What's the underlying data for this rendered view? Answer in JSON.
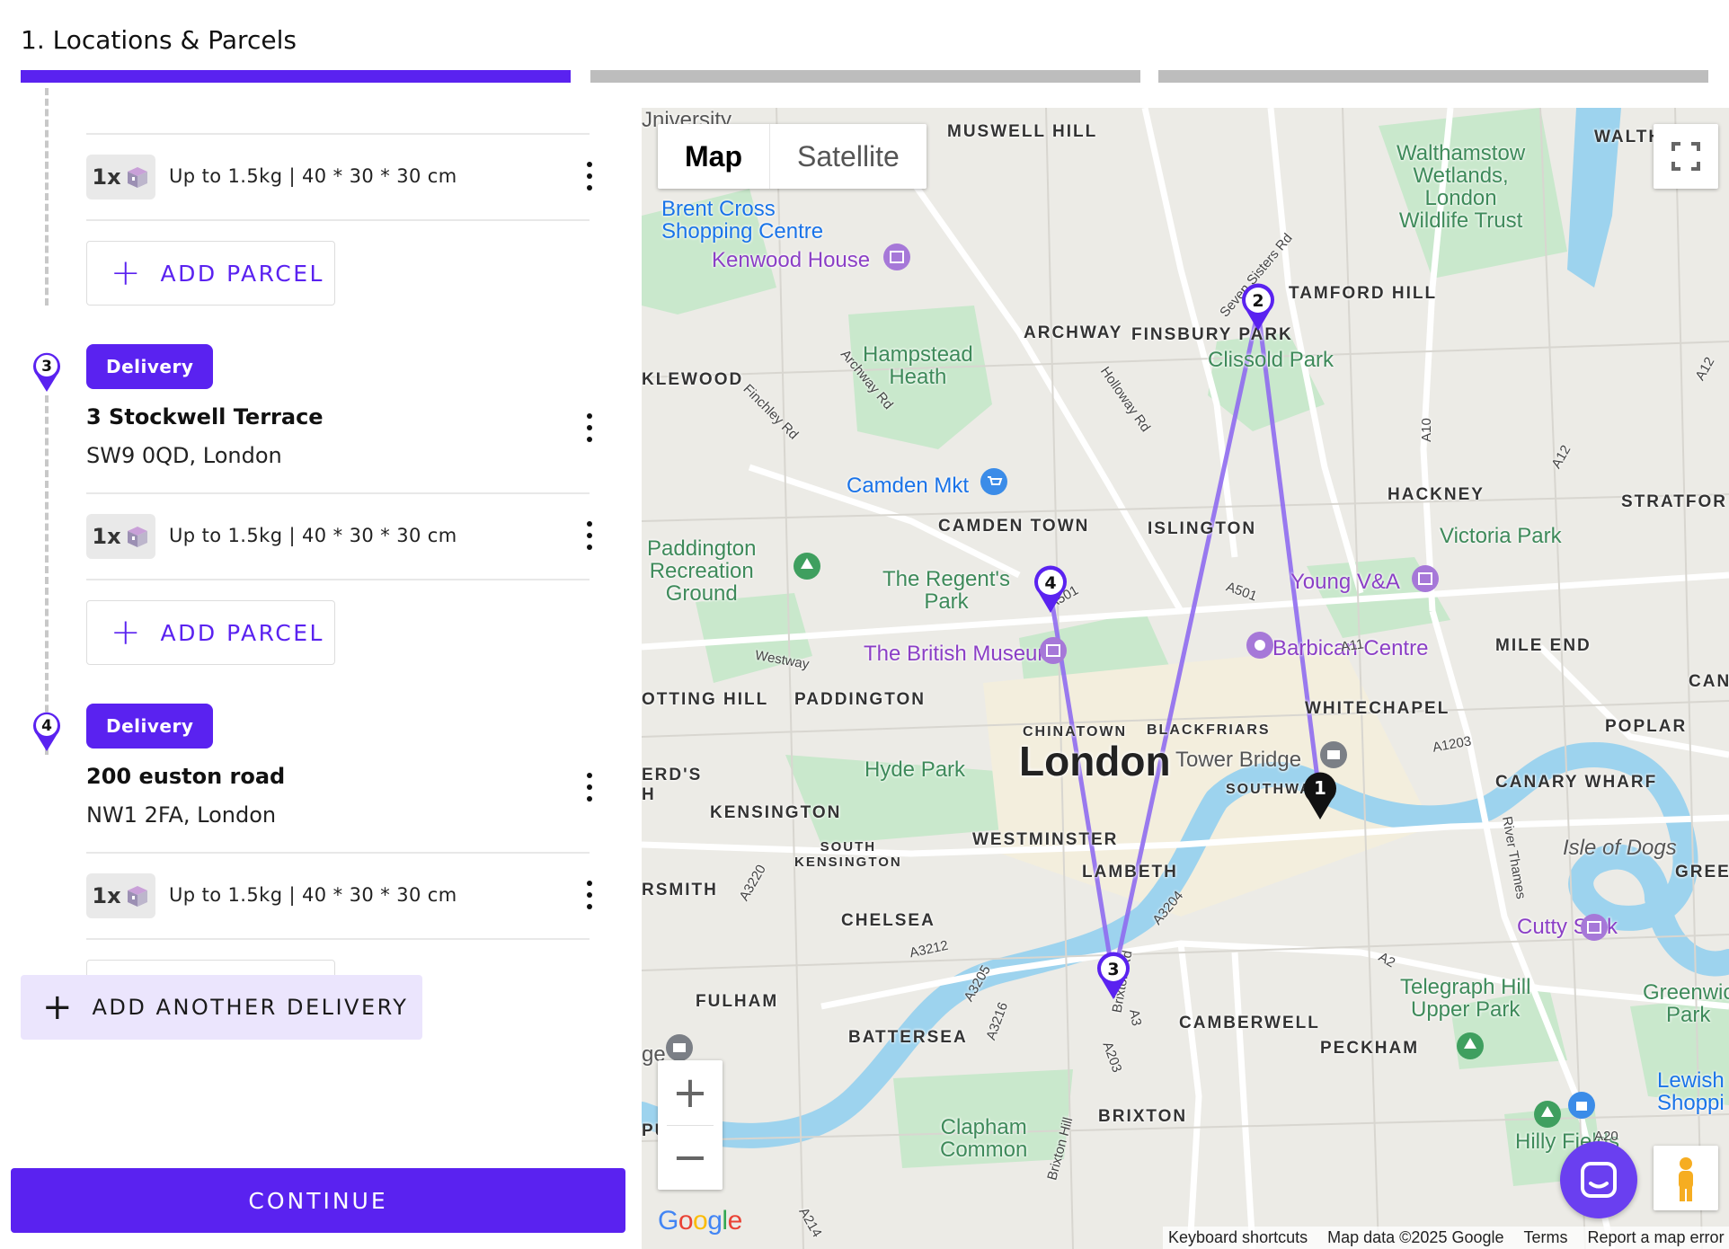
{
  "steps": {
    "current_title": "1. Locations & Parcels",
    "total": 3,
    "active_index": 1
  },
  "parcel_rows": [
    {
      "qty": "1x",
      "description": "Up to 1.5kg | 40 * 30 * 30 cm"
    },
    {
      "qty": "1x",
      "description": "Up to 1.5kg | 40 * 30 * 30 cm"
    },
    {
      "qty": "1x",
      "description": "Up to 1.5kg | 40 * 30 * 30 cm"
    }
  ],
  "stops": [
    {
      "number": "3",
      "type_label": "Delivery",
      "address_line1": "3 Stockwell Terrace",
      "address_line2": "SW9 0QD, London"
    },
    {
      "number": "4",
      "type_label": "Delivery",
      "address_line1": "200 euston road",
      "address_line2": "NW1 2FA, London"
    }
  ],
  "buttons": {
    "add_parcel": "ADD PARCEL",
    "add_another_delivery": "ADD ANOTHER DELIVERY",
    "continue": "CONTINUE"
  },
  "colors": {
    "accent": "#5a22f0",
    "accent_light": "#ebe5fd",
    "route_line": "#8f6cf0"
  },
  "map": {
    "type_tabs": [
      "Map",
      "Satellite"
    ],
    "selected_type": "Map",
    "markers": [
      {
        "label": "1",
        "style": "pickup-black"
      },
      {
        "label": "2",
        "style": "delivery-outline"
      },
      {
        "label": "3",
        "style": "delivery-outline"
      },
      {
        "label": "4",
        "style": "delivery-outline"
      }
    ],
    "labels": {
      "london": "London",
      "camden_town": "CAMDEN TOWN",
      "islington": "ISLINGTON",
      "hackney": "HACKNEY",
      "archway": "ARCHWAY",
      "finsbury_park": "FINSBURY PARK",
      "stamford_hill": "TAMFORD HILL",
      "muswell_hill": "MUSWELL HILL",
      "walthamstow": "WALTHAMST",
      "stratford": "STRATFOR",
      "kilburn": "KLEWOOD",
      "notting_hill": "OTTING HILL",
      "paddington": "PADDINGTON",
      "kensington": "KENSINGTON",
      "south_kensington": "SOUTH\nKENSINGTON",
      "chelsea": "CHELSEA",
      "fulham": "FULHAM",
      "battersea": "BATTERSEA",
      "brixton": "BRIXTON",
      "camberwell": "CAMBERWELL",
      "peckham": "PECKHAM",
      "westminster": "WESTMINSTER",
      "lambeth": "LAMBETH",
      "chinatown": "CHINATOWN",
      "blackfriars": "BLACKFRIARS",
      "southwark": "SOUTHWA",
      "whitechapel": "WHITECHAPEL",
      "poplar": "POPLAR",
      "canary_wharf": "CANARY WHARF",
      "mile_end": "MILE END",
      "greenwich_area": "GREE",
      "hammersmith": "RSMITH",
      "earls": "ERD'S\nH",
      "cann": "CANN",
      "hampstead_heath": "Hampstead\nHeath",
      "clissold_park": "Clissold Park",
      "regents_park": "The Regent's\nPark",
      "hyde_park": "Hyde Park",
      "victoria_park": "Victoria Park",
      "paddington_rec": "Paddington\nRecreation\nGround",
      "walthamstow_wetlands": "Walthamstow\nWetlands,\nLondon\nWildlife Trust",
      "clapham_common": "Clapham\nCommon",
      "telegraph_hill": "Telegraph Hill\nUpper Park",
      "greenwich_park": "Greenwic\nPark",
      "hilly_fields": "Hilly Fields",
      "brent_cross": "Brent Cross\nShopping Centre",
      "kenwood_house": "Kenwood House",
      "camden_mkt": "Camden Mkt",
      "british_museum": "The British Museum",
      "young_va": "Young V&A",
      "barbican": "Barbican Centre",
      "cutty_sark": "Cutty Sark",
      "tower_bridge": "Tower Bridge",
      "isle_of_dogs": "Isle of Dogs",
      "lewisham": "Lewish\nShoppi",
      "university": "Jniversity",
      "river_thames": "River Thames",
      "ge": "ge",
      "pu": "PU",
      "th": "TH",
      "road_a10": "A10",
      "road_a501": "A501",
      "road_a501b": "A501",
      "road_a11": "A11",
      "road_a12": "A12",
      "road_a12b": "A12",
      "road_a1203": "A1203",
      "road_a3212": "A3212",
      "road_a3204": "A3204",
      "road_a3205": "A3205",
      "road_a3216": "A3216",
      "road_a3220": "A3220",
      "road_a203": "A203",
      "road_a2": "A2",
      "road_a20": "A20",
      "road_a214": "A214",
      "road_a3": "A3",
      "archway_rd": "Archway Rd",
      "seven_sisters_rd": "Seven Sisters Rd",
      "holloway_rd": "Holloway Rd",
      "finchley_rd": "Finchley Rd",
      "westway": "Westway",
      "brixton_rd": "Brixton Rd",
      "brixton_hill": "Brixton Hill"
    },
    "google_logo": "Google",
    "attribution": {
      "keyboard": "Keyboard shortcuts",
      "data": "Map data ©2025 Google",
      "terms": "Terms",
      "report": "Report a map error"
    }
  }
}
